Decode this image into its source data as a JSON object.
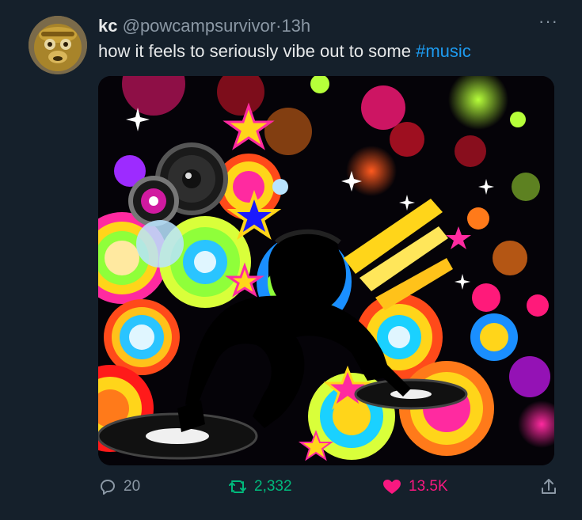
{
  "tweet": {
    "author_name": "kc",
    "author_handle": "@powcampsurvivor",
    "separator": "·",
    "time": "13h",
    "more_label": "···",
    "text": "how it feels to seriously vibe out to some ",
    "hashtag": "#music"
  },
  "stats": {
    "replies": "20",
    "retweets": "2,332",
    "likes": "13.5K"
  },
  "colors": {
    "background": "#15202b",
    "text": "#e7e9ea",
    "muted": "#8b98a5",
    "link": "#1d9bf0",
    "retweet_active": "#00ba7c",
    "like_active": "#f91880"
  },
  "icons": [
    "avatar-monkey",
    "more-icon",
    "reply-icon",
    "retweet-icon",
    "heart-icon",
    "share-icon"
  ]
}
